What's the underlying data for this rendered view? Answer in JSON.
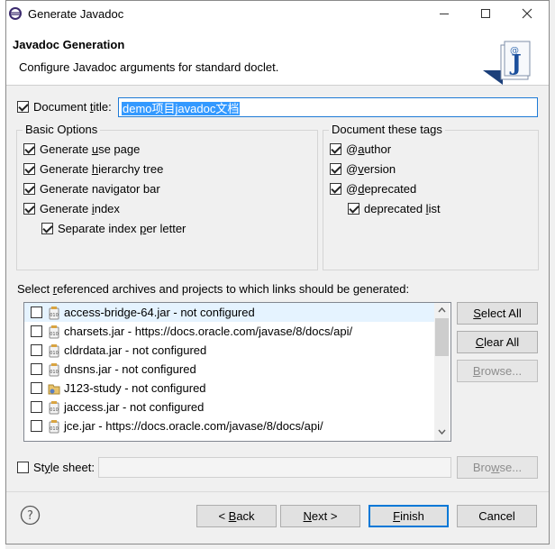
{
  "window": {
    "title": "Generate Javadoc"
  },
  "header": {
    "title": "Javadoc Generation",
    "description": "Configure Javadoc arguments for standard doclet."
  },
  "document_title": {
    "label": "Document title:",
    "value": "demo项目javadoc文档",
    "checked": true
  },
  "basic_options": {
    "title": "Basic Options",
    "items": [
      {
        "label": "Generate use page",
        "checked": true
      },
      {
        "label": "Generate hierarchy tree",
        "checked": true
      },
      {
        "label": "Generate navigator bar",
        "checked": true
      },
      {
        "label": "Generate index",
        "checked": true
      },
      {
        "label": "Separate index per letter",
        "checked": true
      }
    ]
  },
  "document_tags": {
    "title": "Document these tags",
    "items": [
      {
        "label": "@author",
        "checked": true
      },
      {
        "label": "@version",
        "checked": true
      },
      {
        "label": "@deprecated",
        "checked": true
      },
      {
        "label": "deprecated list",
        "checked": true
      }
    ]
  },
  "references": {
    "label": "Select referenced archives and projects to which links should be generated:",
    "items": [
      {
        "label": "access-bridge-64.jar - not configured",
        "checked": false,
        "icon": "jar-icon",
        "selected": true
      },
      {
        "label": "charsets.jar - https://docs.oracle.com/javase/8/docs/api/",
        "checked": false,
        "icon": "jar-icon"
      },
      {
        "label": "cldrdata.jar - not configured",
        "checked": false,
        "icon": "jar-icon"
      },
      {
        "label": "dnsns.jar - not configured",
        "checked": false,
        "icon": "jar-icon"
      },
      {
        "label": "J123-study - not configured",
        "checked": false,
        "icon": "project-icon"
      },
      {
        "label": "jaccess.jar - not configured",
        "checked": false,
        "icon": "jar-icon"
      },
      {
        "label": "jce.jar - https://docs.oracle.com/javase/8/docs/api/",
        "checked": false,
        "icon": "jar-icon"
      }
    ],
    "buttons": {
      "select_all": "Select All",
      "clear_all": "Clear All",
      "browse": "Browse..."
    }
  },
  "style_sheet": {
    "label": "Style sheet:",
    "value": "",
    "checked": false,
    "browse": "Browse..."
  },
  "footer": {
    "back": "< Back",
    "next": "Next >",
    "finish": "Finish",
    "cancel": "Cancel"
  },
  "colors": {
    "selection": "#3399ff",
    "list_highlight": "#e5f3ff",
    "focus_border": "#0078d7"
  }
}
